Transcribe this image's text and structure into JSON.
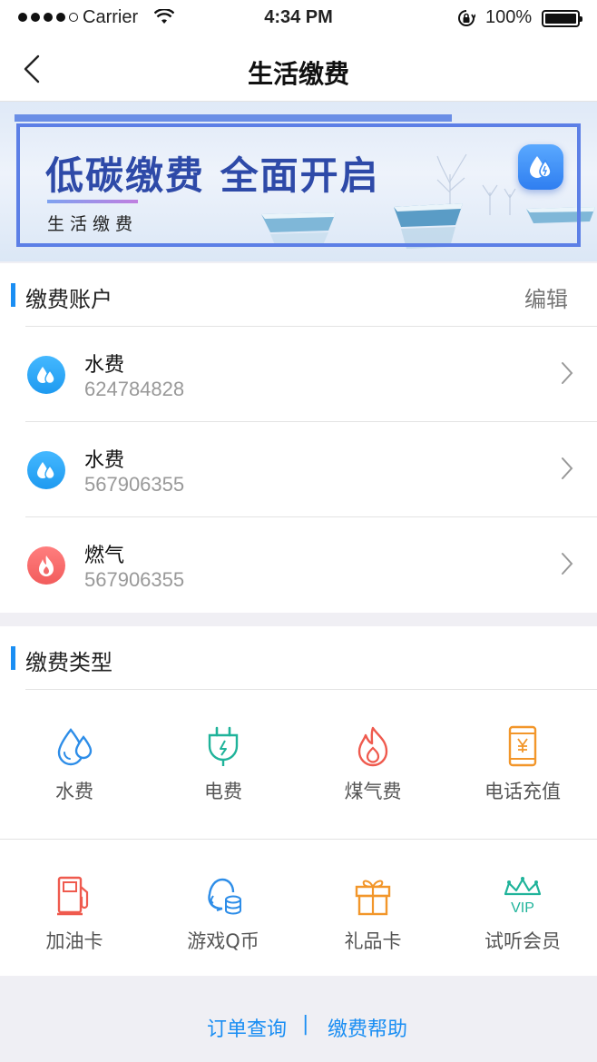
{
  "status_bar": {
    "carrier": "Carrier",
    "time": "4:34 PM",
    "battery": "100%"
  },
  "nav": {
    "title": "生活缴费",
    "back_icon": "chevron-left-icon"
  },
  "banner": {
    "headline": "低碳缴费 全面开启",
    "subtitle": "生活缴费",
    "badge_icon": "water-drop-icon",
    "frame_color": "#5c7fe6",
    "headline_color": "#2e4aa8"
  },
  "accounts_section": {
    "title": "缴费账户",
    "edit_label": "编辑",
    "items": [
      {
        "icon": "water-icon",
        "name": "水费",
        "number": "624784828"
      },
      {
        "icon": "water-icon",
        "name": "水费",
        "number": "567906355"
      },
      {
        "icon": "gas-flame-icon",
        "name": "燃气",
        "number": "567906355"
      }
    ]
  },
  "types_section": {
    "title": "缴费类型",
    "items": [
      {
        "icon": "water-drops-icon",
        "label": "水费",
        "color": "#2d8de8"
      },
      {
        "icon": "power-plug-icon",
        "label": "电费",
        "color": "#1fb39a"
      },
      {
        "icon": "flame-icon",
        "label": "煤气费",
        "color": "#ef5a4e"
      },
      {
        "icon": "phone-yen-icon",
        "label": "电话充值",
        "color": "#f2962a"
      },
      {
        "icon": "fuel-pump-icon",
        "label": "加油卡",
        "color": "#ef5a4e"
      },
      {
        "icon": "game-coin-icon",
        "label": "游戏Q币",
        "color": "#2d8de8"
      },
      {
        "icon": "gift-box-icon",
        "label": "礼品卡",
        "color": "#f2962a"
      },
      {
        "icon": "vip-crown-icon",
        "label": "试听会员",
        "color": "#1fb39a"
      }
    ]
  },
  "footer": {
    "order_query": "订单查询",
    "separator": "|",
    "help": "缴费帮助",
    "link_color": "#1a8ef3"
  }
}
